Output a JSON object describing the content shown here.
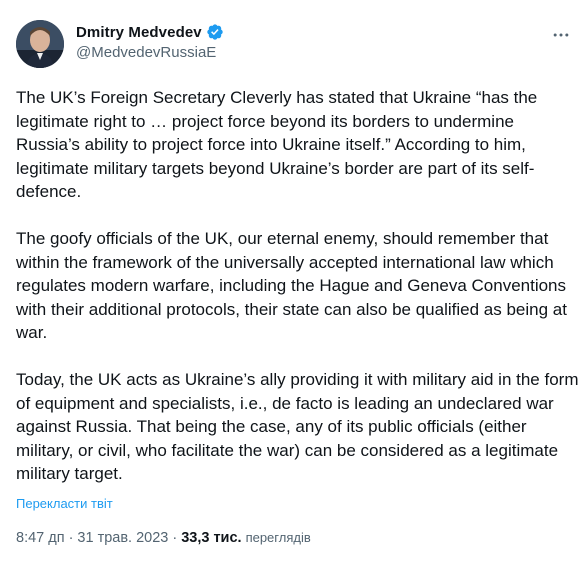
{
  "author": {
    "display_name": "Dmitry Medvedev",
    "handle": "@MedvedevRussiaE",
    "verified": true,
    "avatar_icon": "profile-photo"
  },
  "tweet": {
    "paragraphs": [
      "The UK’s Foreign Secretary Cleverly has stated that Ukraine “has the legitimate right to … project force beyond its borders to undermine Russia’s ability to project force into Ukraine itself.” According to him, legitimate military targets beyond Ukraine’s border are part of its self-defence.",
      "The goofy officials of the UK, our eternal enemy, should remember that within the framework of the universally accepted international law which regulates modern warfare, including the Hague and Geneva Conventions with their additional protocols, their state can also be qualified as being at war.",
      "Today, the UK acts as Ukraine’s ally providing it with military aid in the form of equipment and specialists, i.e., de facto is leading an undeclared war against Russia. That being the case, any of its public officials (either military, or civil, who facilitate the war) can be considered as a legitimate military target."
    ],
    "translate_label": "Перекласти твіт",
    "time": "8:47 дп",
    "separator": "·",
    "date": "31 трав. 2023",
    "views_count": "33,3 тис.",
    "views_label": "переглядів"
  },
  "colors": {
    "text": "#0f1419",
    "secondary": "#536471",
    "link": "#1d9bf0",
    "verified_badge": "#1d9bf0"
  },
  "icons": {
    "verified": "verified-badge-icon",
    "more": "more-options-icon"
  }
}
